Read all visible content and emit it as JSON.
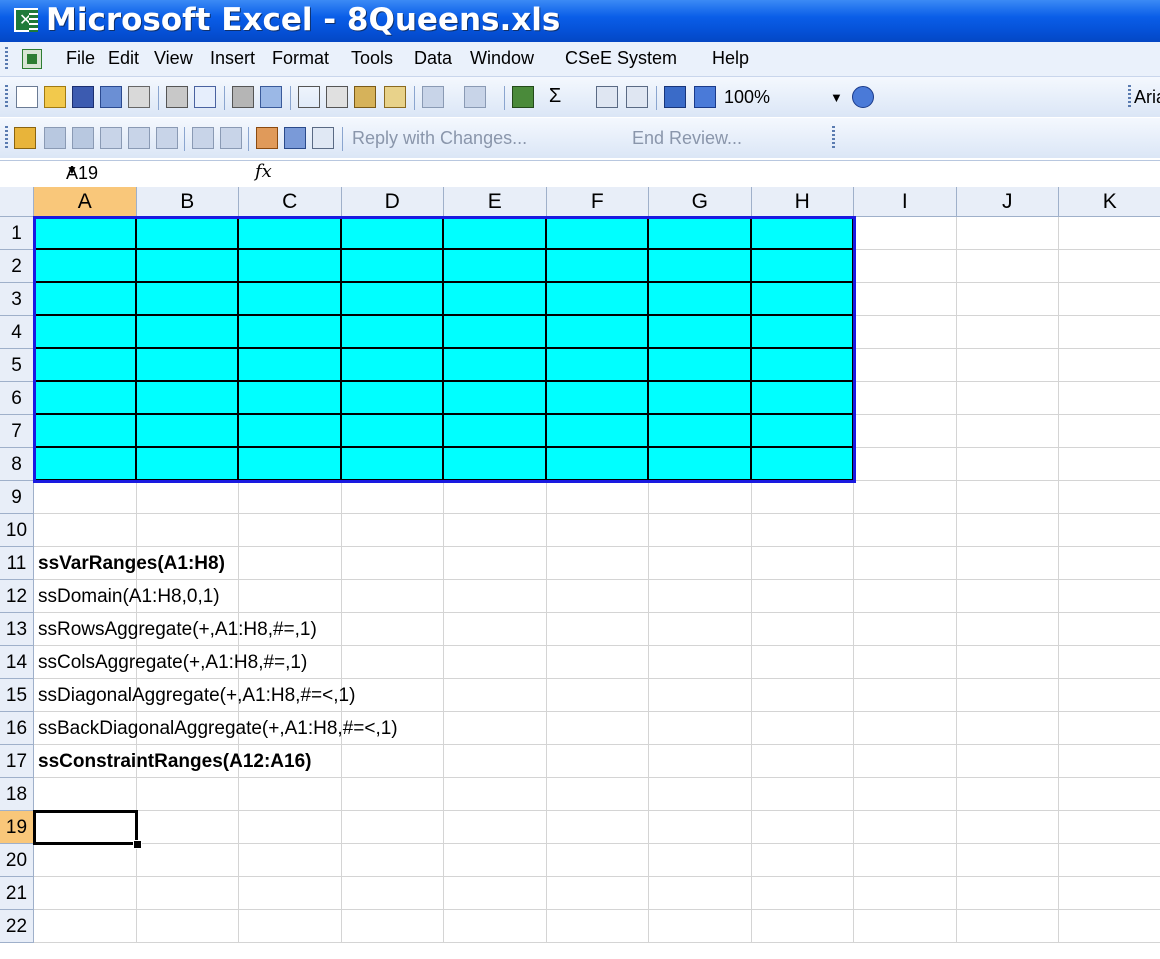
{
  "window": {
    "title": "Microsoft Excel - 8Queens.xls"
  },
  "menu": {
    "items": [
      "File",
      "Edit",
      "View",
      "Insert",
      "Format",
      "Tools",
      "Data",
      "Window",
      "CSeE System",
      "Help"
    ]
  },
  "toolbar": {
    "zoom": "100%",
    "font": "Arial",
    "reply_label": "Reply with Changes...",
    "end_review_label": "End Review..."
  },
  "formula_bar": {
    "name_box": "A19",
    "fx": "fx",
    "content": ""
  },
  "grid": {
    "columns": [
      "A",
      "B",
      "C",
      "D",
      "E",
      "F",
      "G",
      "H",
      "I",
      "J",
      "K"
    ],
    "rows": [
      "1",
      "2",
      "3",
      "4",
      "5",
      "6",
      "7",
      "8",
      "9",
      "10",
      "11",
      "12",
      "13",
      "14",
      "15",
      "16",
      "17",
      "18",
      "19",
      "20",
      "21",
      "22"
    ],
    "selected_cell": "A19",
    "board_range": "A1:H8",
    "board_color": "#00ffff",
    "board_outline_color": "#1a1ae0",
    "cells": [
      {
        "row": 11,
        "text": "ssVarRanges(A1:H8)",
        "bold": true
      },
      {
        "row": 12,
        "text": "ssDomain(A1:H8,0,1)",
        "bold": false
      },
      {
        "row": 13,
        "text": "ssRowsAggregate(+,A1:H8,#=,1)",
        "bold": false
      },
      {
        "row": 14,
        "text": "ssColsAggregate(+,A1:H8,#=,1)",
        "bold": false
      },
      {
        "row": 15,
        "text": "ssDiagonalAggregate(+,A1:H8,#=<,1)",
        "bold": false
      },
      {
        "row": 16,
        "text": "ssBackDiagonalAggregate(+,A1:H8,#=<,1)",
        "bold": false
      },
      {
        "row": 17,
        "text": "ssConstraintRanges(A12:A16)",
        "bold": true
      }
    ]
  },
  "colors": {
    "title_bar": "#0a5ee8",
    "header_bg": "#e8eef8",
    "header_selected": "#f9c77a"
  }
}
